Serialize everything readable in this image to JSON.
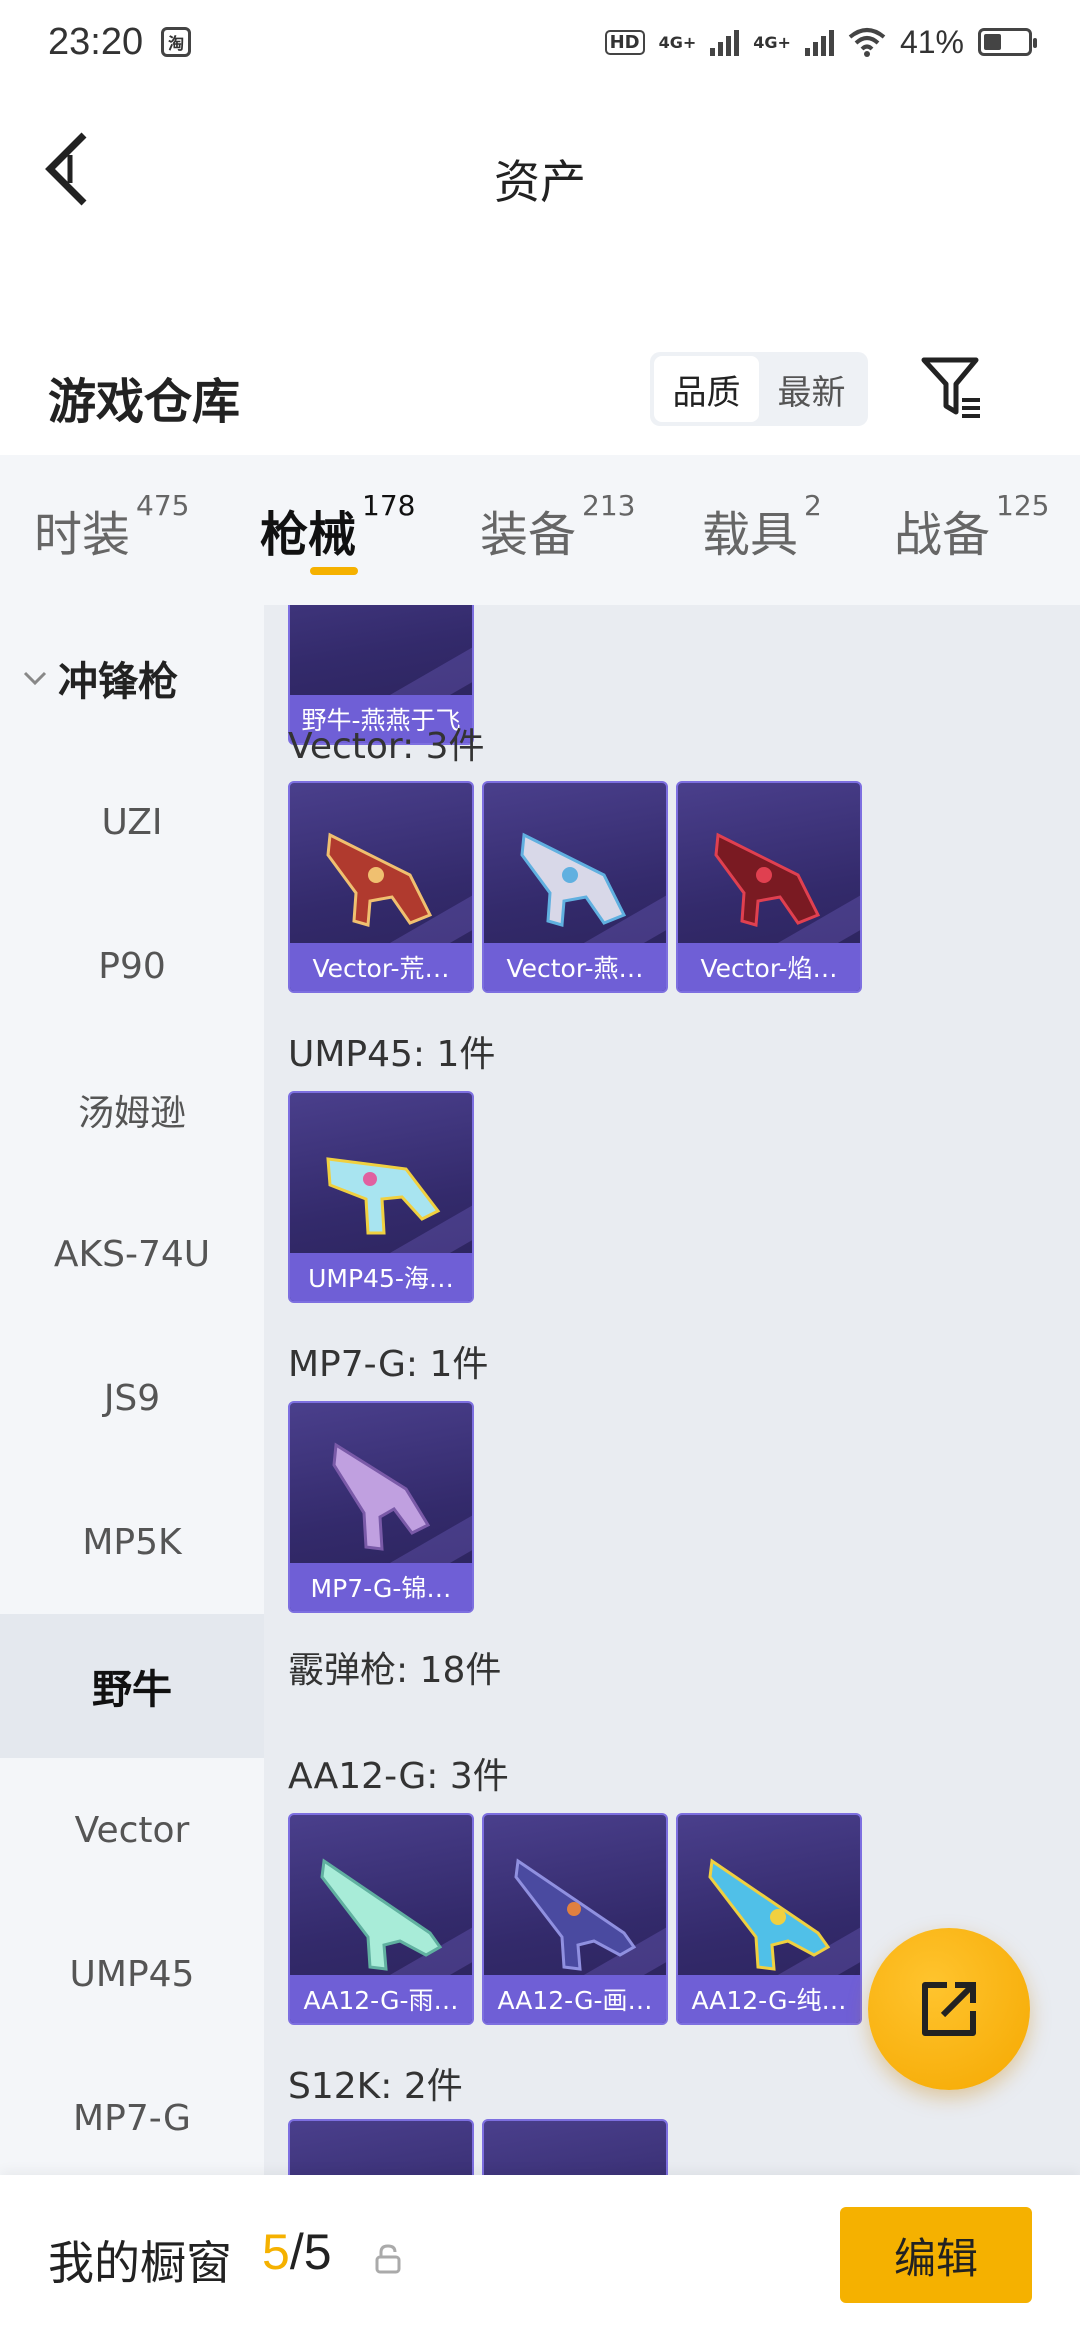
{
  "status_bar": {
    "time": "23:20",
    "app_icon": "淘",
    "hd_label": "HD",
    "net1": "4G+",
    "net2": "4G+",
    "battery": "41%",
    "battery_level": 0.41
  },
  "header": {
    "title": "资产"
  },
  "warehouse": {
    "title": "游戏仓库",
    "sort_options": [
      "品质",
      "最新"
    ],
    "sort_active": "品质"
  },
  "tabs": [
    {
      "label": "时装",
      "count": "475"
    },
    {
      "label": "枪械",
      "count": "178"
    },
    {
      "label": "装备",
      "count": "213"
    },
    {
      "label": "载具",
      "count": "2"
    },
    {
      "label": "战备",
      "count": "125"
    }
  ],
  "active_tab": "枪械",
  "sidebar": {
    "group": "冲锋枪",
    "items": [
      "UZI",
      "P90",
      "汤姆逊",
      "AKS-74U",
      "JS9",
      "MP5K",
      "野牛",
      "Vector",
      "UMP45",
      "MP7-G"
    ],
    "active": "野牛"
  },
  "content": {
    "partial_card": "野牛-燕燕于飞",
    "sections": [
      {
        "title": "Vector: 3件",
        "items": [
          "Vector-荒…",
          "Vector-燕…",
          "Vector-焰…"
        ]
      },
      {
        "title": "UMP45: 1件",
        "items": [
          "UMP45-海…"
        ]
      },
      {
        "title": "MP7-G: 1件",
        "items": [
          "MP7-G-锦…"
        ]
      },
      {
        "title": "霰弹枪: 18件",
        "items": []
      },
      {
        "title": "AA12-G: 3件",
        "items": [
          "AA12-G-雨…",
          "AA12-G-画…",
          "AA12-G-纯…"
        ]
      },
      {
        "title": "S12K: 2件",
        "items": []
      }
    ]
  },
  "bottom_bar": {
    "label": "我的橱窗",
    "current": "5",
    "separator": "/",
    "total": "5",
    "edit_label": "编辑"
  },
  "colors": {
    "accent": "#f5b100",
    "card_bg": "#3a307a",
    "card_label": "#6f5fd6"
  }
}
